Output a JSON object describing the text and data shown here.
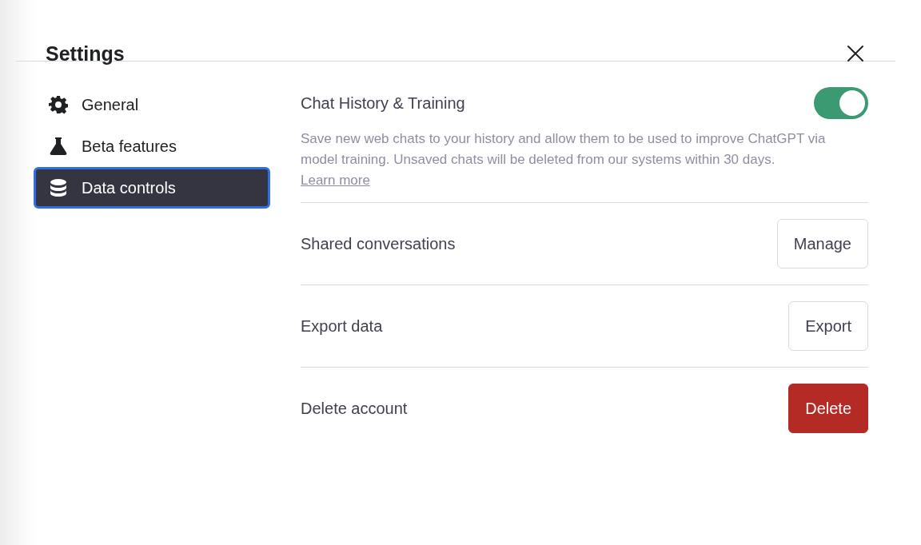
{
  "title": "Settings",
  "sidebar": {
    "items": [
      {
        "label": "General",
        "selected": false
      },
      {
        "label": "Beta features",
        "selected": false
      },
      {
        "label": "Data controls",
        "selected": true
      }
    ]
  },
  "settings": [
    {
      "kind": "toggle",
      "label": "Chat History & Training",
      "on": true,
      "description": "Save new web chats to your history and allow them to be used to improve ChatGPT via model training. Unsaved chats will be deleted from our systems within 30 days.",
      "link": "Learn more"
    },
    {
      "kind": "button",
      "label": "Shared conversations",
      "button": "Manage"
    },
    {
      "kind": "button",
      "label": "Export data",
      "button": "Export"
    },
    {
      "kind": "danger",
      "label": "Delete account",
      "button": "Delete"
    }
  ]
}
